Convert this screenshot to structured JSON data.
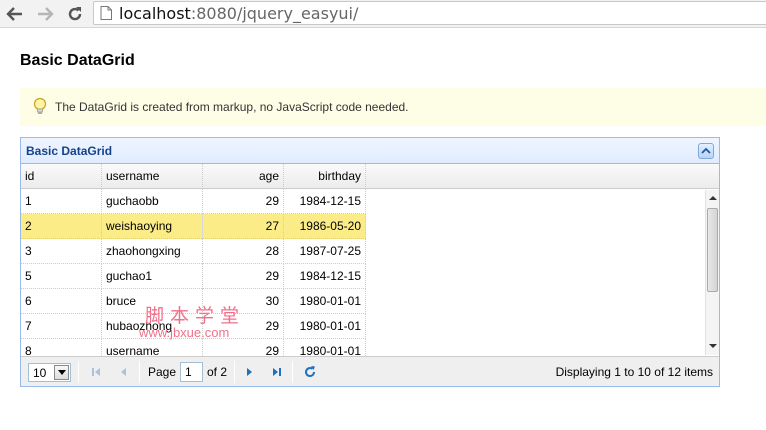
{
  "browser": {
    "url_host": "localhost",
    "url_rest": ":8080/jquery_easyui/"
  },
  "page": {
    "title": "Basic DataGrid",
    "note": "The DataGrid is created from markup, no JavaScript code needed."
  },
  "grid": {
    "title": "Basic DataGrid",
    "columns": [
      "id",
      "username",
      "age",
      "birthday"
    ],
    "rows": [
      {
        "id": "1",
        "username": "guchaobb",
        "age": "29",
        "birthday": "1984-12-15"
      },
      {
        "id": "2",
        "username": "weishaoying",
        "age": "27",
        "birthday": "1986-05-20"
      },
      {
        "id": "3",
        "username": "zhaohongxing",
        "age": "28",
        "birthday": "1987-07-25"
      },
      {
        "id": "5",
        "username": "guchao1",
        "age": "29",
        "birthday": "1984-12-15"
      },
      {
        "id": "6",
        "username": "bruce",
        "age": "30",
        "birthday": "1980-01-01"
      },
      {
        "id": "7",
        "username": "hubaozhong",
        "age": "29",
        "birthday": "1980-01-01"
      },
      {
        "id": "8",
        "username": "username",
        "age": "29",
        "birthday": "1980-01-01"
      }
    ],
    "selected_row": 1
  },
  "pager": {
    "page_size": "10",
    "page_label": "Page",
    "page_number": "1",
    "of_label": "of 2",
    "info": "Displaying 1 to 10 of 12 items"
  },
  "watermark": {
    "line1": "脚本学堂",
    "line2": "www.jbxue.com"
  },
  "colors": {
    "panel_border": "#99bbe8",
    "panel_title": "#15428b",
    "selected_row": "#fbec88",
    "note_bg": "#fefee6",
    "watermark": "#f0718b"
  },
  "icons": {
    "back": "arrow-left-icon",
    "forward": "arrow-right-icon",
    "reload": "reload-icon",
    "note": "lightbulb-icon",
    "collapse": "collapse-icon",
    "first": "first-page-icon",
    "prev": "prev-page-icon",
    "next": "next-page-icon",
    "last": "last-page-icon",
    "refresh": "refresh-icon"
  }
}
